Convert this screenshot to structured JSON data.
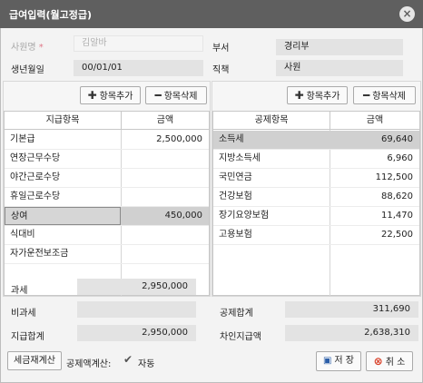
{
  "window": {
    "title": "급여입력(월고정급)",
    "close_icon": "close-icon"
  },
  "header": {
    "employee_label": "사원명",
    "employee_required": "*",
    "employee_value": "김알바",
    "dept_label": "부서",
    "dept_value": "경리부",
    "birth_label": "생년월일",
    "birth_value": "00/01/01",
    "position_label": "직책",
    "position_value": "사원"
  },
  "toolbar": {
    "add_label": "항목추가",
    "delete_label": "항목삭제"
  },
  "pay_table": {
    "columns": [
      "지급항목",
      "금액"
    ],
    "rows": [
      {
        "item": "기본급",
        "amount": "2,500,000"
      },
      {
        "item": "연장근무수당",
        "amount": ""
      },
      {
        "item": "야간근로수당",
        "amount": ""
      },
      {
        "item": "휴일근로수당",
        "amount": ""
      },
      {
        "item": "상여",
        "amount": "450,000"
      },
      {
        "item": "식대비",
        "amount": ""
      },
      {
        "item": "자가운전보조금",
        "amount": ""
      }
    ]
  },
  "deduction_table": {
    "columns": [
      "공제항목",
      "금액"
    ],
    "rows": [
      {
        "item": "소득세",
        "amount": "69,640"
      },
      {
        "item": "지방소득세",
        "amount": "6,960"
      },
      {
        "item": "국민연금",
        "amount": "112,500"
      },
      {
        "item": "건강보험",
        "amount": "88,620"
      },
      {
        "item": "장기요양보험",
        "amount": "11,470"
      },
      {
        "item": "고용보험",
        "amount": "22,500"
      }
    ]
  },
  "summary": {
    "taxable_label": "과세",
    "taxable_value": "2,950,000",
    "nontaxable_label": "비과세",
    "nontaxable_value": "",
    "total_pay_label": "지급합계",
    "total_pay_value": "2,950,000",
    "total_deduction_label": "공제합계",
    "total_deduction_value": "311,690",
    "net_pay_label": "차인지급액",
    "net_pay_value": "2,638,310"
  },
  "footer": {
    "recalc_label": "세금재계산",
    "deduction_calc_label": "공제액계산:",
    "auto_label": "자동",
    "auto_checked": true,
    "save_label": "저 장",
    "cancel_label": "취 소"
  }
}
